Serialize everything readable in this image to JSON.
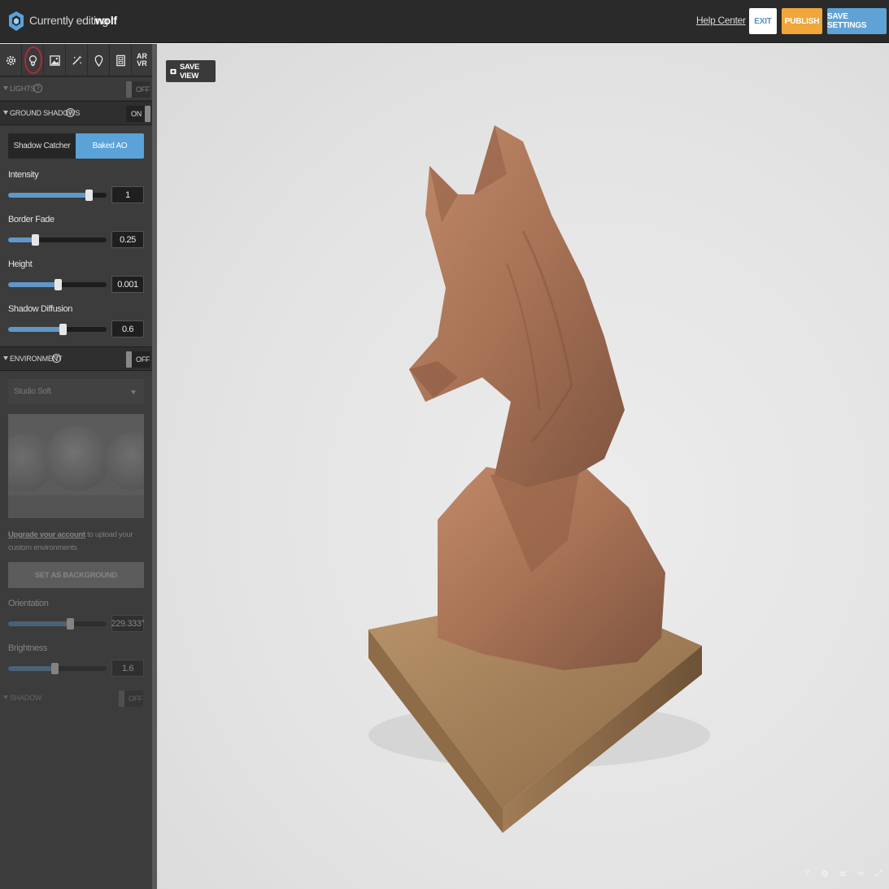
{
  "header": {
    "title_prefix": "Currently editing",
    "model_name": "wolf",
    "help_label": "Help Center",
    "exit_label": "EXIT",
    "publish_label": "PUBLISH",
    "save_settings_label": "SAVE SETTINGS",
    "colors": {
      "publish": "#f0a63a",
      "save": "#5fa3d6",
      "exit_text": "#5a8fc0"
    }
  },
  "tabs": [
    {
      "icon": "gear-icon"
    },
    {
      "icon": "lightbulb-icon",
      "active": true
    },
    {
      "icon": "image-icon"
    },
    {
      "icon": "magic-wand-icon"
    },
    {
      "icon": "map-pin-icon"
    },
    {
      "icon": "film-icon"
    },
    {
      "label_top": "AR",
      "label_bottom": "VR"
    }
  ],
  "lights": {
    "label": "LIGHTS",
    "help": "?",
    "toggle": "OFF"
  },
  "ground_shadows": {
    "label": "GROUND SHADOWS",
    "help": "?",
    "toggle": "ON",
    "modes": [
      "Shadow Catcher",
      "Baked AO"
    ],
    "selected_mode": "Baked AO",
    "controls": [
      {
        "label": "Intensity",
        "value": "1",
        "level": 0.82
      },
      {
        "label": "Border Fade",
        "value": "0.25",
        "level": 0.27
      },
      {
        "label": "Height",
        "value": "0.001",
        "level": 0.5
      },
      {
        "label": "Shadow Diffusion",
        "value": "0.6",
        "level": 0.55
      }
    ]
  },
  "environment": {
    "label": "ENVIRONMENT",
    "help": "?",
    "toggle": "OFF",
    "selected": "Studio Soft",
    "upgrade_link": "Upgrade your account",
    "upgrade_text": " to upload your custom environments",
    "set_background_label": "SET AS BACKGROUND",
    "controls": [
      {
        "label": "Orientation",
        "value": "229.333°",
        "level": 0.63
      },
      {
        "label": "Brightness",
        "value": "1.6",
        "level": 0.47
      }
    ],
    "shadow_label": "SHADOW",
    "shadow_toggle": "OFF"
  },
  "viewport": {
    "save_view_label": "SAVE VIEW",
    "icons": [
      "help-icon",
      "settings-icon",
      "layers-icon",
      "vr-icon",
      "fullscreen-icon"
    ]
  }
}
